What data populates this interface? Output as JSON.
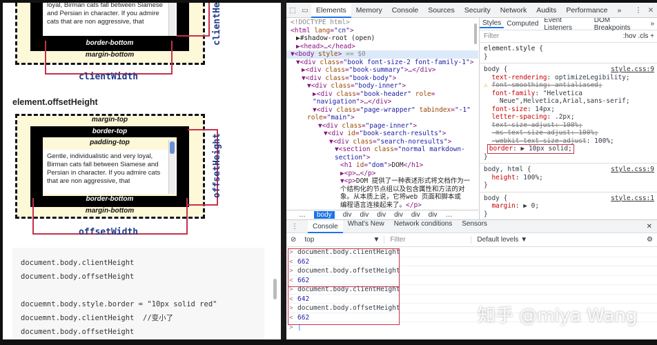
{
  "left": {
    "diagram1": {
      "body_text": "loyal, Birman cats fall between Siamese and Persian in character. If you admire cats that are non aggressive, that",
      "border_bottom": "border-bottom",
      "margin_bottom": "margin-bottom",
      "width_label": "clientWidth",
      "height_label": "clientHeight"
    },
    "heading": "element.offsetHeight",
    "diagram2": {
      "margin_top": "margin-top",
      "border_top": "border-top",
      "padding_top": "padding-top",
      "body_text": "Gentle, individualistic and very loyal, Birman cats fall between Siamese and Persian in character. If you admire cats that are non aggressive, that",
      "border_bottom": "border-bottom",
      "margin_bottom": "margin-bottom",
      "width_label": "offsetWidth",
      "height_label": "offsetHeight"
    },
    "code": [
      "document.body.clientHeight",
      "document.body.offsetHeight",
      "",
      "docuemnt.body.style.border = \"10px solid red\"",
      "docuemnt.body.clientHeight  //变小了",
      "document.body.offsetHeight"
    ]
  },
  "devtools": {
    "tabs": [
      "Elements",
      "Memory",
      "Console",
      "Sources",
      "Security",
      "Network",
      "Audits",
      "Performance",
      "»"
    ],
    "active_tab": "Elements",
    "dom": [
      {
        "ind": 0,
        "html": "<span class='g'>&lt;!DOCTYPE html&gt;</span>"
      },
      {
        "ind": 0,
        "html": "&lt;html <span class='a'>lang</span>=<span class='v'>\"cn\"</span>&gt;"
      },
      {
        "ind": 1,
        "html": "<span class='x'>▶#shadow-root (open)</span>"
      },
      {
        "ind": 1,
        "html": "▶&lt;head&gt;…&lt;/head&gt;"
      },
      {
        "ind": 0,
        "sel": true,
        "html": "▼&lt;body <span class='a'>style</span>&gt; <span class='g'>== $0</span>"
      },
      {
        "ind": 1,
        "html": "▼&lt;div <span class='a'>class</span>=<span class='v'>\"book font-size-2 font-family-1\"</span>&gt;"
      },
      {
        "ind": 2,
        "html": "▶&lt;div <span class='a'>class</span>=<span class='v'>\"book-summary\"</span>&gt;…&lt;/div&gt;"
      },
      {
        "ind": 2,
        "html": "▼&lt;div <span class='a'>class</span>=<span class='v'>\"book-body\"</span>&gt;"
      },
      {
        "ind": 3,
        "html": "▼&lt;div <span class='a'>class</span>=<span class='v'>\"body-inner\"</span>&gt;"
      },
      {
        "ind": 4,
        "html": "▶&lt;div <span class='a'>class</span>=<span class='v'>\"book-header\"</span> <span class='a'>role</span>="
      },
      {
        "ind": 4,
        "html": "<span class='v'>\"navigation\"</span>&gt;…&lt;/div&gt;"
      },
      {
        "ind": 4,
        "html": "▼&lt;div <span class='a'>class</span>=<span class='v'>\"page-wrapper\"</span> <span class='a'>tabindex</span>=<span class='v'>\"-1\"</span>"
      },
      {
        "ind": 3,
        "html": "<span class='a'>role</span>=<span class='v'>\"main\"</span>&gt;"
      },
      {
        "ind": 5,
        "html": "▼&lt;div <span class='a'>class</span>=<span class='v'>\"page-inner\"</span>&gt;"
      },
      {
        "ind": 6,
        "html": "▼&lt;div <span class='a'>id</span>=<span class='v'>\"book-search-results\"</span>&gt;"
      },
      {
        "ind": 7,
        "html": "▼&lt;div <span class='a'>class</span>=<span class='v'>\"search-noresults\"</span>&gt;"
      },
      {
        "ind": 8,
        "html": "▼&lt;section <span class='a'>class</span>=<span class='v'>\"normal markdown-</span>"
      },
      {
        "ind": 8,
        "html": "<span class='v'>section\"</span>&gt;"
      },
      {
        "ind": 9,
        "html": "&lt;h1 <span class='a'>id</span>=<span class='v'>\"dom\"</span>&gt;<span class='x'>DOM</span>&lt;/h1&gt;"
      },
      {
        "ind": 9,
        "html": "▶&lt;p&gt;…&lt;/p&gt;"
      },
      {
        "ind": 9,
        "html": "▼&lt;p&gt;<span class='x'>DOM 提供了一种表述形式将文档作为一</span>"
      },
      {
        "ind": 9,
        "html": "<span class='x'>个结构化的节点组以及包含属性和方法的对</span>"
      },
      {
        "ind": 9,
        "html": "<span class='x'>象。从本质上说，它将web 页面和脚本或</span>"
      },
      {
        "ind": 9,
        "html": "<span class='x'>编程语言连接起来了。</span>&lt;/p&gt;"
      },
      {
        "ind": 9,
        "html": "▶&lt;p&gt;…&lt;/p&gt;"
      }
    ],
    "breadcrumbs": [
      "…",
      "body",
      "div",
      "div",
      "div",
      "div",
      "div",
      "div",
      "…"
    ],
    "styles_tabs": [
      "Styles",
      "Computed",
      "Event Listeners",
      "DOM Breakpoints",
      "»"
    ],
    "filter_placeholder": "Filter",
    "filter_right": ":hov  .cls  +",
    "console_tabs": [
      "Console",
      "What's New",
      "Network conditions",
      "Sensors"
    ],
    "console_context": "top",
    "console_filter": "Filter",
    "console_levels": "Default levels ▼",
    "console": [
      {
        "type": "in",
        "text": "document.body.clientHeight"
      },
      {
        "type": "out",
        "text": "662"
      },
      {
        "type": "in",
        "text": "document.body.offsetHeight"
      },
      {
        "type": "out",
        "text": "662"
      },
      {
        "type": "in",
        "text": "document.body.clientHeight"
      },
      {
        "type": "out",
        "text": "642"
      },
      {
        "type": "in",
        "text": "document.body.offsetHeight"
      },
      {
        "type": "out",
        "text": "662"
      }
    ]
  },
  "watermark": "知乎 @miya Wang"
}
